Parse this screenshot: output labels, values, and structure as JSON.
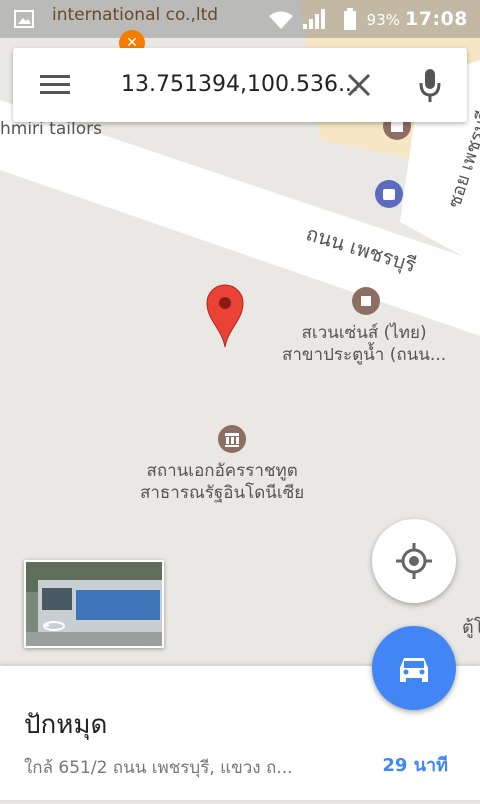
{
  "status_bar": {
    "time": "17:08",
    "battery": "93%"
  },
  "search": {
    "value": "13.751394,100.536..."
  },
  "map": {
    "labels": {
      "top_business": "international co.,ltd",
      "left_business": "hmiri tailors",
      "road_main": "ถนน เพชรบุรี",
      "road_side": "ซอย เพชรบุรี",
      "seven_eleven": "สเวนเซ่นส์ (ไทย)\nสาขาประตูน้ำ (ถนน...",
      "embassy": "สถานเอกอัครราชทูต\nสาธารณรัฐอินโดนีเซีย",
      "edge_label": "ตู้โ"
    }
  },
  "bottom_sheet": {
    "title": "ปักหมุด",
    "address": "ใกล้ 651/2 ถนน เพชรบุรี, แขวง ถ...",
    "eta": "29 นาที"
  },
  "colors": {
    "accent": "#4285f4",
    "pin": "#ea4335"
  }
}
